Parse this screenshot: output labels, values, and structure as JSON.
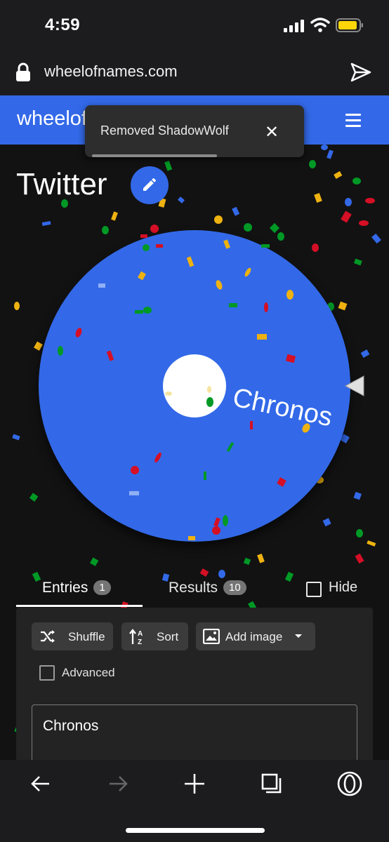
{
  "status_bar": {
    "time": "4:59"
  },
  "browser": {
    "url": "wheelofnames.com"
  },
  "app_bar": {
    "brand": "wheelof"
  },
  "toast": {
    "message": "Removed ShadowWolf",
    "close": "✕"
  },
  "wheel_title": "Twitter",
  "wheel": {
    "segments": [
      "Chronos"
    ],
    "color": "#3369e8"
  },
  "tabs": [
    {
      "label": "Entries",
      "count": "1",
      "active": true
    },
    {
      "label": "Results",
      "count": "10",
      "active": false
    }
  ],
  "hide": {
    "label": "Hide",
    "checked": false
  },
  "toolbar": {
    "shuffle": "Shuffle",
    "sort": "Sort",
    "add_image": "Add image"
  },
  "advanced": {
    "label": "Advanced",
    "checked": false
  },
  "entries_text": "Chronos",
  "bottom_toolbar": {
    "icons": [
      "back-arrow-icon",
      "forward-arrow-icon",
      "new-tab-plus-icon",
      "tabs-icon",
      "opera-menu-icon"
    ]
  },
  "colors": {
    "accent": "#3369e8",
    "background": "#121212",
    "panel": "#232323"
  }
}
